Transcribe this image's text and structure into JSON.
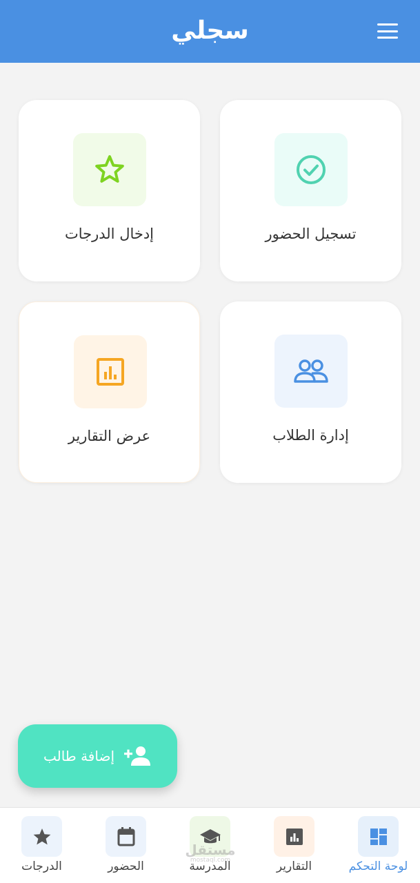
{
  "header": {
    "title": "سجلي"
  },
  "cards": [
    {
      "label": "تسجيل الحضور",
      "icon": "check-circle-icon",
      "bg": "#eafcf8",
      "color": "#50d2b0"
    },
    {
      "label": "إدخال الدرجات",
      "icon": "star-icon",
      "bg": "#f1fbe8",
      "color": "#7ed321"
    },
    {
      "label": "إدارة الطلاب",
      "icon": "people-icon",
      "bg": "#edf4fd",
      "color": "#4a90e2"
    },
    {
      "label": "عرض التقارير",
      "icon": "report-chart-icon",
      "bg": "#fff4e6",
      "color": "#f5a623"
    }
  ],
  "fab": {
    "label": "إضافة طالب",
    "icon": "person-add-icon"
  },
  "bottom_nav": [
    {
      "label": "لوحة التحكم",
      "icon": "dashboard-icon",
      "active": true
    },
    {
      "label": "التقارير",
      "icon": "report-icon"
    },
    {
      "label": "المدرسة",
      "icon": "school-cap-icon"
    },
    {
      "label": "الحضور",
      "icon": "calendar-icon"
    },
    {
      "label": "الدرجات",
      "icon": "star-icon"
    }
  ],
  "colors": {
    "primary": "#4a90e2",
    "fab": "#50e3c2",
    "background": "#f3f3f3"
  },
  "watermark": {
    "text": "مستقل",
    "sub": "mostaql.com"
  }
}
